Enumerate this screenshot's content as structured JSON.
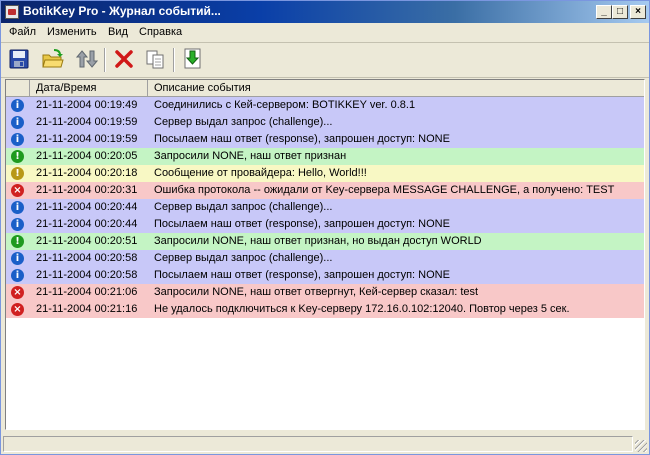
{
  "window": {
    "title": "BotikKey Pro - Журнал событий..."
  },
  "menu": [
    "Файл",
    "Изменить",
    "Вид",
    "Справка"
  ],
  "toolbar": [
    {
      "icon": "save-icon"
    },
    {
      "icon": "open-folder-icon"
    },
    {
      "icon": "sort-arrows-icon"
    },
    {
      "icon": "delete-icon"
    },
    {
      "icon": "copy-icon"
    },
    {
      "icon": "export-icon"
    }
  ],
  "columns": {
    "icon": "",
    "datetime": "Дата/Время",
    "description": "Описание события"
  },
  "colors": {
    "info": "#c8c8f8",
    "success": "#c4f4c4",
    "message": "#f8f8c4",
    "error": "#f8c8c8"
  },
  "rows": [
    {
      "type": "info",
      "datetime": "21-11-2004 00:19:49",
      "description": "Соединились с Кей-сервером: BOTIKKEY ver. 0.8.1"
    },
    {
      "type": "info",
      "datetime": "21-11-2004 00:19:59",
      "description": "Сервер выдал запрос (challenge)..."
    },
    {
      "type": "info",
      "datetime": "21-11-2004 00:19:59",
      "description": "Посылаем наш ответ (response), запрошен доступ: NONE"
    },
    {
      "type": "success",
      "datetime": "21-11-2004 00:20:05",
      "description": "Запросили NONE, наш ответ признан"
    },
    {
      "type": "message",
      "datetime": "21-11-2004 00:20:18",
      "description": "Сообщение от провайдера: Hello, World!!!"
    },
    {
      "type": "error",
      "datetime": "21-11-2004 00:20:31",
      "description": "Ошибка протокола -- ожидали от Key-сервера MESSAGE CHALLENGE, а получено: TEST"
    },
    {
      "type": "info",
      "datetime": "21-11-2004 00:20:44",
      "description": "Сервер выдал запрос (challenge)..."
    },
    {
      "type": "info",
      "datetime": "21-11-2004 00:20:44",
      "description": "Посылаем наш ответ (response), запрошен доступ: NONE"
    },
    {
      "type": "success",
      "datetime": "21-11-2004 00:20:51",
      "description": "Запросили NONE, наш ответ признан, но выдан доступ WORLD"
    },
    {
      "type": "info",
      "datetime": "21-11-2004 00:20:58",
      "description": "Сервер выдал запрос (challenge)..."
    },
    {
      "type": "info",
      "datetime": "21-11-2004 00:20:58",
      "description": "Посылаем наш ответ (response), запрошен доступ: NONE"
    },
    {
      "type": "error",
      "datetime": "21-11-2004 00:21:06",
      "description": "Запросили NONE, наш ответ отвергнут, Кей-сервер сказал: test"
    },
    {
      "type": "error",
      "datetime": "21-11-2004 00:21:16",
      "description": "Не удалось подключиться к Key-серверу 172.16.0.102:12040. Повтор через 5 сек."
    }
  ]
}
